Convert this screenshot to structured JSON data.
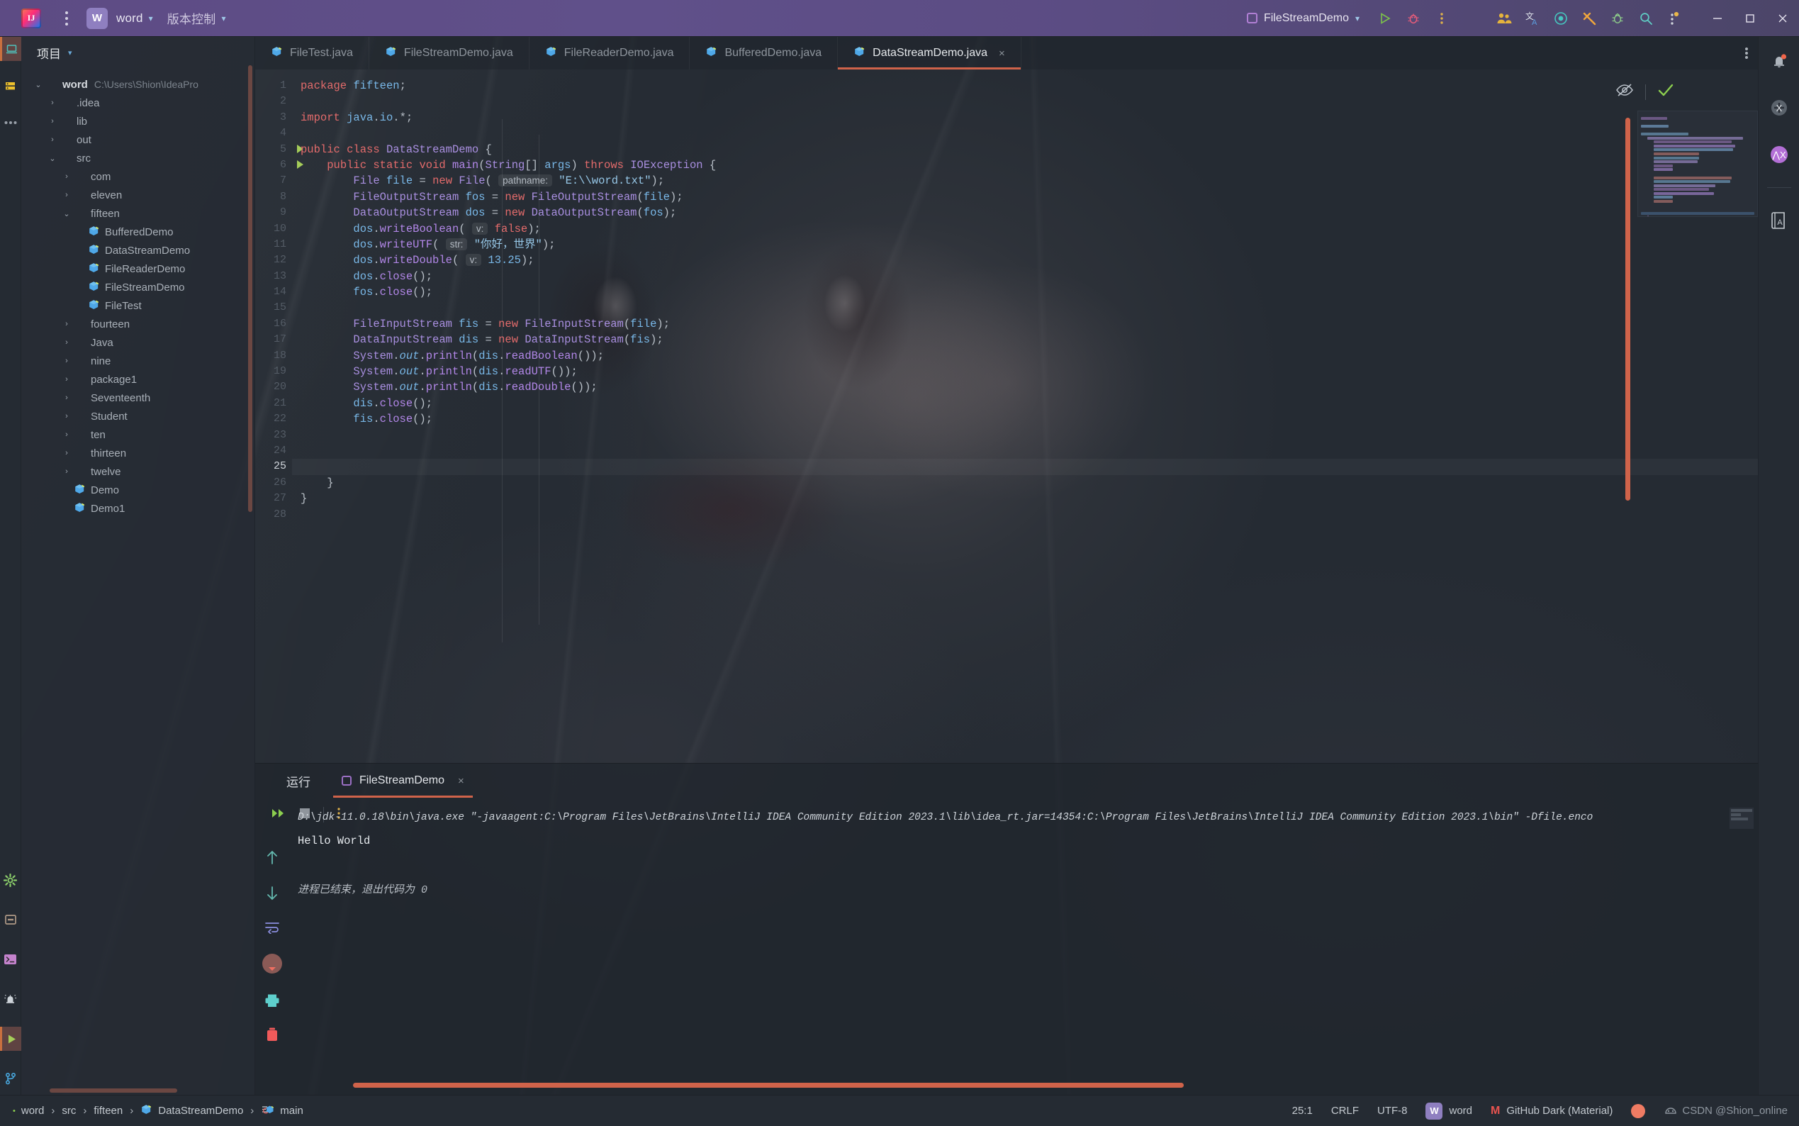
{
  "titlebar": {
    "logo": "IJ",
    "menu_icon": "vertical-dots-icon",
    "project_chip": "W",
    "project_name": "word",
    "vcs_label": "版本控制",
    "run_config": "FileStreamDemo",
    "icons": [
      "run-icon",
      "debug-icon",
      "more-actions-icon",
      "collaborate-icon",
      "translate-icon",
      "ai-assistant-icon",
      "tools-icon",
      "bug-report-icon",
      "search-icon",
      "updates-icon"
    ],
    "window_buttons": [
      "minimize",
      "maximize",
      "close"
    ]
  },
  "left_rail": {
    "items": [
      {
        "name": "project-tool-window",
        "icon": "laptop-icon",
        "active": true
      },
      {
        "name": "structure-tool-window",
        "icon": "server-icon",
        "active": false
      },
      {
        "name": "more-tool-windows",
        "icon": "dots-icon",
        "active": false
      }
    ],
    "bottom_items": [
      {
        "name": "settings",
        "icon": "gear-icon"
      },
      {
        "name": "build",
        "icon": "build-icon"
      },
      {
        "name": "terminal",
        "icon": "terminal-icon"
      },
      {
        "name": "problems",
        "icon": "bell-icon"
      },
      {
        "name": "run",
        "icon": "run-icon",
        "active": true
      },
      {
        "name": "version-control",
        "icon": "branch-icon"
      }
    ]
  },
  "project": {
    "title": "项目",
    "tree": [
      {
        "label": "word",
        "path": "C:\\Users\\Shion\\IdeaPro",
        "depth": 0,
        "state": "expanded",
        "kind": "module"
      },
      {
        "label": ".idea",
        "depth": 1,
        "state": "collapsed",
        "kind": "folder"
      },
      {
        "label": "lib",
        "depth": 1,
        "state": "collapsed",
        "kind": "folder"
      },
      {
        "label": "out",
        "depth": 1,
        "state": "collapsed",
        "kind": "folder"
      },
      {
        "label": "src",
        "depth": 1,
        "state": "expanded",
        "kind": "folder"
      },
      {
        "label": "com",
        "depth": 2,
        "state": "collapsed",
        "kind": "package"
      },
      {
        "label": "eleven",
        "depth": 2,
        "state": "collapsed",
        "kind": "package"
      },
      {
        "label": "fifteen",
        "depth": 2,
        "state": "expanded",
        "kind": "package"
      },
      {
        "label": "BufferedDemo",
        "depth": 3,
        "state": "leaf",
        "kind": "class"
      },
      {
        "label": "DataStreamDemo",
        "depth": 3,
        "state": "leaf",
        "kind": "class"
      },
      {
        "label": "FileReaderDemo",
        "depth": 3,
        "state": "leaf",
        "kind": "class"
      },
      {
        "label": "FileStreamDemo",
        "depth": 3,
        "state": "leaf",
        "kind": "class"
      },
      {
        "label": "FileTest",
        "depth": 3,
        "state": "leaf",
        "kind": "class"
      },
      {
        "label": "fourteen",
        "depth": 2,
        "state": "collapsed",
        "kind": "package"
      },
      {
        "label": "Java",
        "depth": 2,
        "state": "collapsed",
        "kind": "package"
      },
      {
        "label": "nine",
        "depth": 2,
        "state": "collapsed",
        "kind": "package"
      },
      {
        "label": "package1",
        "depth": 2,
        "state": "collapsed",
        "kind": "package"
      },
      {
        "label": "Seventeenth",
        "depth": 2,
        "state": "collapsed",
        "kind": "package"
      },
      {
        "label": "Student",
        "depth": 2,
        "state": "collapsed",
        "kind": "package"
      },
      {
        "label": "ten",
        "depth": 2,
        "state": "collapsed",
        "kind": "package"
      },
      {
        "label": "thirteen",
        "depth": 2,
        "state": "collapsed",
        "kind": "package"
      },
      {
        "label": "twelve",
        "depth": 2,
        "state": "collapsed",
        "kind": "package"
      },
      {
        "label": "Demo",
        "depth": 2,
        "state": "leaf",
        "kind": "class"
      },
      {
        "label": "Demo1",
        "depth": 2,
        "state": "leaf",
        "kind": "class"
      }
    ]
  },
  "tabs": [
    {
      "label": "FileTest.java",
      "active": false
    },
    {
      "label": "FileStreamDemo.java",
      "active": false
    },
    {
      "label": "FileReaderDemo.java",
      "active": false
    },
    {
      "label": "BufferedDemo.java",
      "active": false
    },
    {
      "label": "DataStreamDemo.java",
      "active": true,
      "close": "×"
    }
  ],
  "editor": {
    "total_lines": 28,
    "current_line": 25,
    "run_markers": [
      5,
      6
    ],
    "inspection_status": "ok-check",
    "reader_mode_icon": "eye-off-icon",
    "lines": [
      {
        "n": 1,
        "text": "package fifteen;"
      },
      {
        "n": 2,
        "text": ""
      },
      {
        "n": 3,
        "text": "import java.io.*;"
      },
      {
        "n": 4,
        "text": ""
      },
      {
        "n": 5,
        "text": "public class DataStreamDemo {"
      },
      {
        "n": 6,
        "text": "    public static void main(String[] args) throws IOException {"
      },
      {
        "n": 7,
        "text": "        File file = new File( pathname: \"E:\\\\word.txt\");"
      },
      {
        "n": 8,
        "text": "        FileOutputStream fos = new FileOutputStream(file);"
      },
      {
        "n": 9,
        "text": "        DataOutputStream dos = new DataOutputStream(fos);"
      },
      {
        "n": 10,
        "text": "        dos.writeBoolean( v: false);"
      },
      {
        "n": 11,
        "text": "        dos.writeUTF( str: \"你好，世界\");"
      },
      {
        "n": 12,
        "text": "        dos.writeDouble( v: 13.25);"
      },
      {
        "n": 13,
        "text": "        dos.close();"
      },
      {
        "n": 14,
        "text": "        fos.close();"
      },
      {
        "n": 15,
        "text": ""
      },
      {
        "n": 16,
        "text": "        FileInputStream fis = new FileInputStream(file);"
      },
      {
        "n": 17,
        "text": "        DataInputStream dis = new DataInputStream(fis);"
      },
      {
        "n": 18,
        "text": "        System.out.println(dis.readBoolean());"
      },
      {
        "n": 19,
        "text": "        System.out.println(dis.readUTF());"
      },
      {
        "n": 20,
        "text": "        System.out.println(dis.readDouble());"
      },
      {
        "n": 21,
        "text": "        dis.close();"
      },
      {
        "n": 22,
        "text": "        fis.close();"
      },
      {
        "n": 23,
        "text": ""
      },
      {
        "n": 24,
        "text": ""
      },
      {
        "n": 25,
        "text": ""
      },
      {
        "n": 26,
        "text": "    }"
      },
      {
        "n": 27,
        "text": "}"
      },
      {
        "n": 28,
        "text": ""
      }
    ],
    "hint_params": [
      "pathname:",
      "v:",
      "str:",
      "v:"
    ]
  },
  "run_panel": {
    "title": "运行",
    "tab_label": "FileStreamDemo",
    "tab_close": "×",
    "toolbar": [
      {
        "name": "rerun-button",
        "icon": "fast-forward-icon"
      },
      {
        "name": "stop-button",
        "icon": "stop-icon"
      },
      {
        "name": "more-button",
        "icon": "vertical-dots-icon"
      }
    ],
    "side_tools": [
      {
        "name": "scroll-up-button",
        "icon": "arrow-up-icon"
      },
      {
        "name": "scroll-down-button",
        "icon": "arrow-down-icon"
      },
      {
        "name": "soft-wrap-button",
        "icon": "wrap-icon"
      },
      {
        "name": "scroll-to-end-button",
        "icon": "scroll-end-icon"
      },
      {
        "name": "print-button",
        "icon": "printer-icon"
      },
      {
        "name": "clear-all-button",
        "icon": "trash-icon"
      }
    ],
    "console": {
      "command": "D:\\jdk-11.0.18\\bin\\java.exe \"-javaagent:C:\\Program Files\\JetBrains\\IntelliJ IDEA Community Edition 2023.1\\lib\\idea_rt.jar=14354:C:\\Program Files\\JetBrains\\IntelliJ IDEA Community Edition 2023.1\\bin\" -Dfile.enco",
      "output": "Hello World",
      "exit": "进程已结束，退出代码为 0"
    }
  },
  "status_bar": {
    "breadcrumbs": [
      "word",
      "src",
      "fifteen",
      "DataStreamDemo",
      "main"
    ],
    "caret": "25:1",
    "line_sep": "CRLF",
    "encoding": "UTF-8",
    "project_chip": "W",
    "project": "word",
    "theme": "GitHub Dark (Material)",
    "watermark": "CSDN @Shion_online"
  },
  "right_rail": {
    "items": [
      {
        "name": "notifications",
        "icon": "bell-icon",
        "badge": true
      },
      {
        "name": "maven",
        "icon": "maven-icon"
      },
      {
        "name": "ai-chat",
        "icon": "ai-icon"
      },
      {
        "name": "translation",
        "icon": "dictionary-icon"
      }
    ]
  },
  "colors": {
    "accent": "#d0634a",
    "titlebar": "#5d4b84",
    "editor_bg": "#252b33",
    "keyword": "#e36b6b",
    "type": "#a98fe0",
    "method": "#b287e8",
    "variable": "#79b8e8",
    "string": "#97c8e8",
    "param_hint": "#d6a14a"
  }
}
